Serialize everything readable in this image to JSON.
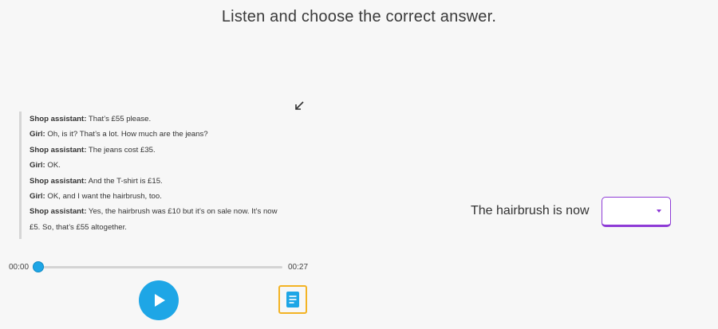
{
  "instruction": "Listen and choose the correct answer.",
  "transcript": {
    "lines": [
      {
        "speaker": "Shop assistant:",
        "text": " That’s £55 please."
      },
      {
        "speaker": "Girl:",
        "text": " Oh, is it? That’s a lot. How much are the jeans?"
      },
      {
        "speaker": "Shop assistant:",
        "text": " The jeans cost £35."
      },
      {
        "speaker": "Girl:",
        "text": " OK."
      },
      {
        "speaker": "Shop assistant:",
        "text": " And the T-shirt is £15."
      },
      {
        "speaker": "Girl:",
        "text": " OK, and I want the hairbrush, too."
      },
      {
        "speaker": "Shop assistant:",
        "text": " Yes, the hairbrush was £10 but it’s on sale now.  It’s now"
      },
      {
        "speaker": "",
        "text": "£5. So, that’s £55 altogether."
      }
    ]
  },
  "player": {
    "current_time": "00:00",
    "total_time": "00:27",
    "progress": 0
  },
  "question": {
    "prompt": "The hairbrush is now",
    "selected_value": ""
  },
  "icons": {
    "collapse": "collapse-arrow-icon",
    "play": "play-icon",
    "transcript": "transcript-document-icon",
    "dropdown": "caret-down-icon"
  },
  "colors": {
    "accent_blue": "#1ea6e6",
    "dropdown_purple": "#8e3bd6",
    "transcript_button_border": "#f3b324"
  }
}
